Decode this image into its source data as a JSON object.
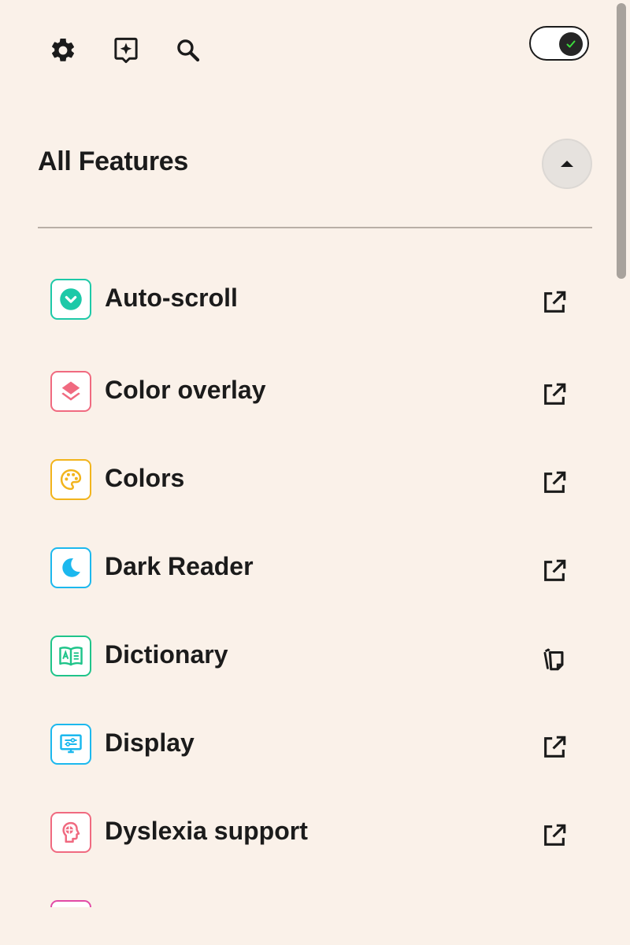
{
  "header": {
    "icons": [
      "gear-icon",
      "sparkle-chat-icon",
      "search-icon"
    ],
    "toggle": {
      "state": "on",
      "check_color": "#3ddc3d"
    }
  },
  "section": {
    "title": "All Features",
    "collapse_icon": "caret-up-icon"
  },
  "features": [
    {
      "label": "Auto-scroll",
      "icon": "chevron-down-circle-icon",
      "color": "#1dc9a8",
      "action_icon": "open-external-icon"
    },
    {
      "label": "Color overlay",
      "icon": "layers-icon",
      "color": "#f06a80",
      "action_icon": "open-external-icon"
    },
    {
      "label": "Colors",
      "icon": "palette-icon",
      "color": "#f2b41c",
      "action_icon": "open-external-icon"
    },
    {
      "label": "Dark Reader",
      "icon": "moon-icon",
      "color": "#1cb8ee",
      "action_icon": "open-external-icon"
    },
    {
      "label": "Dictionary",
      "icon": "book-translate-icon",
      "color": "#1fc48a",
      "action_icon": "copy-icon"
    },
    {
      "label": "Display",
      "icon": "monitor-settings-icon",
      "color": "#1cb8ee",
      "action_icon": "open-external-icon"
    },
    {
      "label": "Dyslexia support",
      "icon": "head-brain-icon",
      "color": "#f06a80",
      "action_icon": "open-external-icon"
    },
    {
      "label": "",
      "icon": "partial-feature-icon",
      "color": "#e24aa6",
      "action_icon": ""
    }
  ],
  "colors": {
    "background": "#faf1e9",
    "text": "#1b1b1b",
    "divider": "#b9afa6"
  }
}
